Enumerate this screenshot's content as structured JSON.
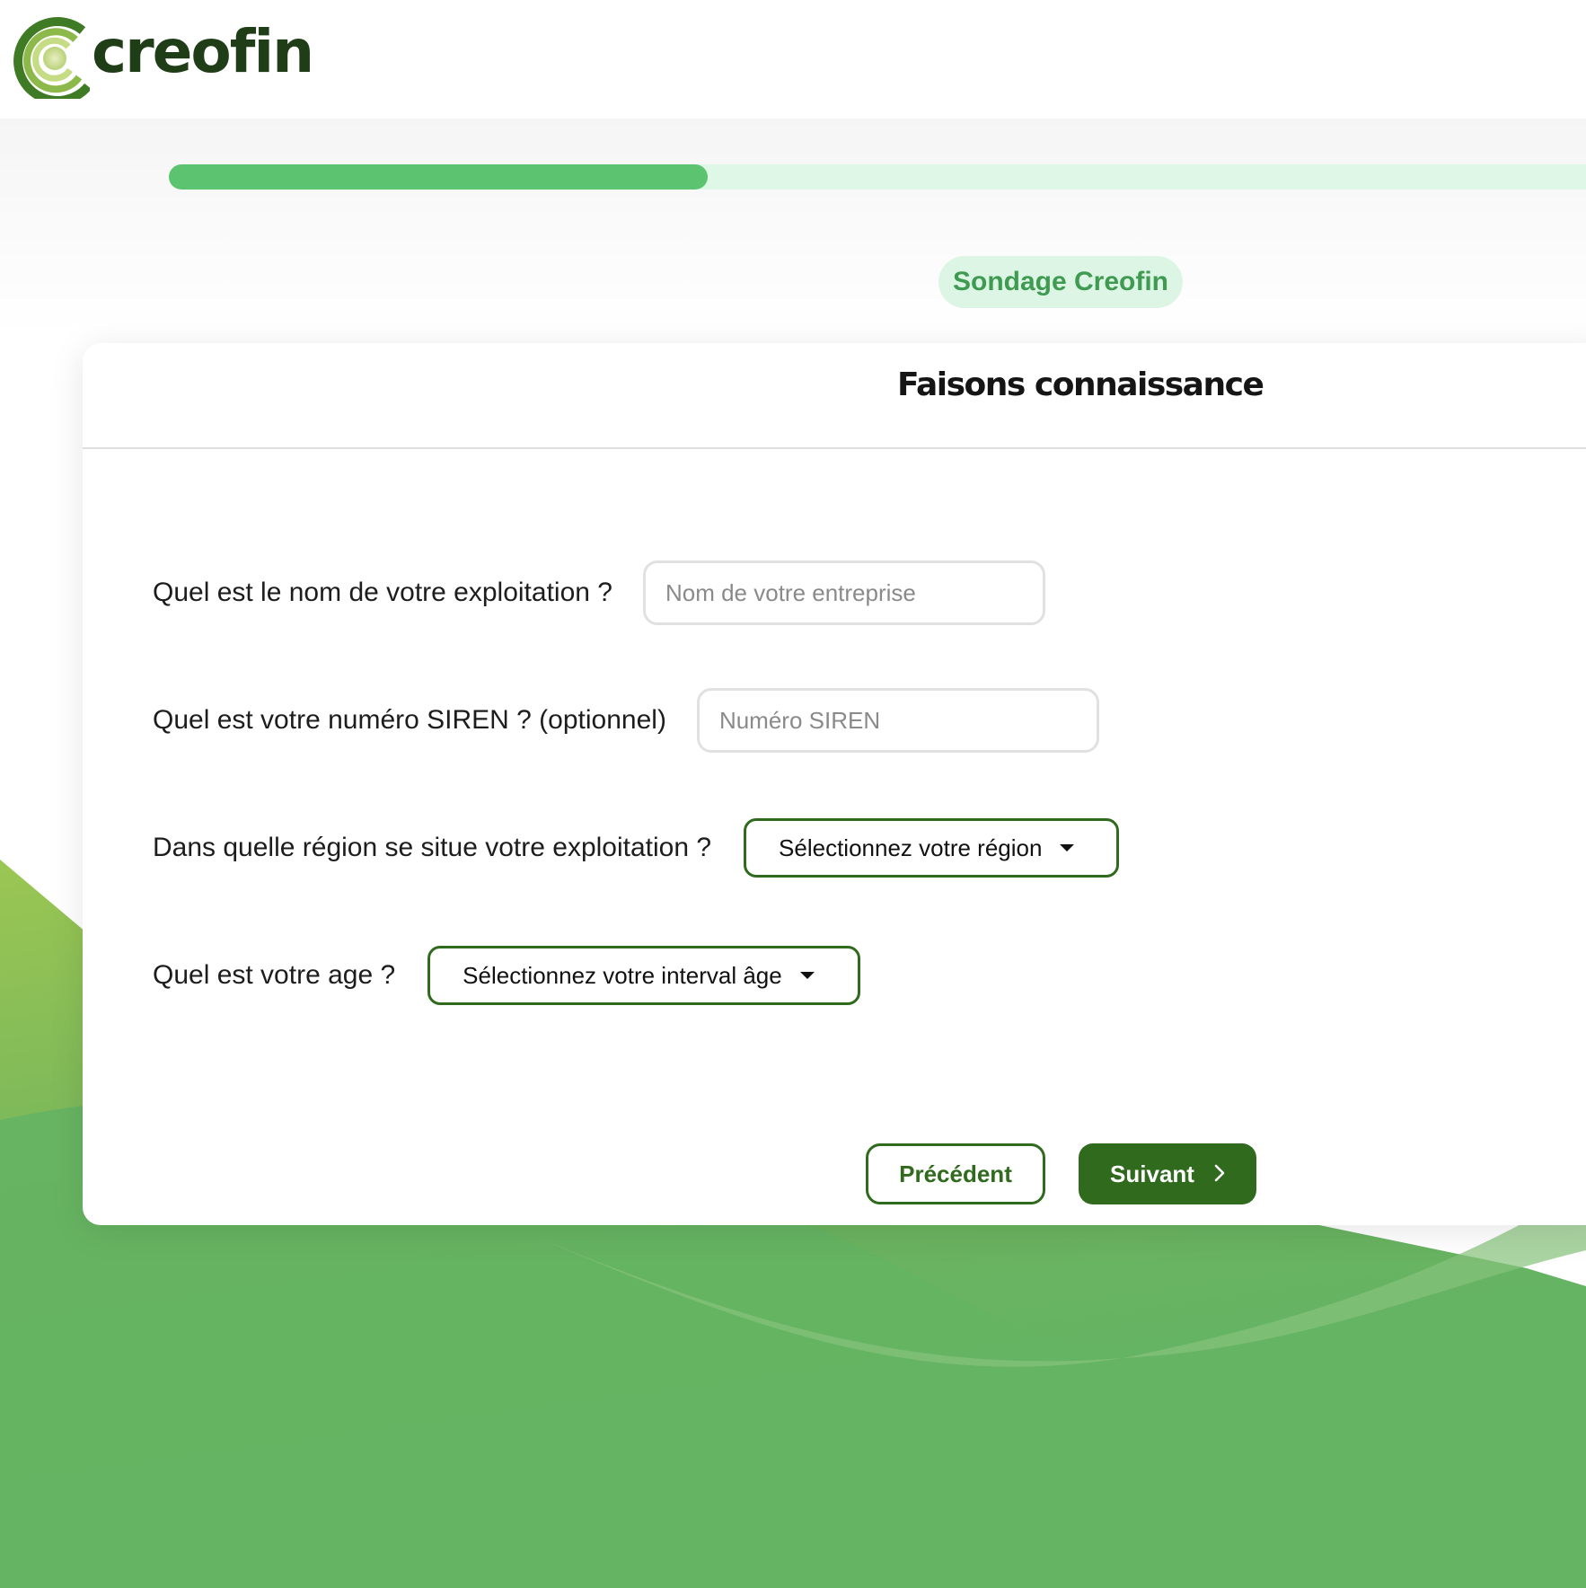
{
  "brand": {
    "name": "creofin"
  },
  "progress": {
    "percent": 38
  },
  "survey": {
    "badge": "Sondage Creofin",
    "title": "Faisons connaissance"
  },
  "questions": {
    "company_name": {
      "label": "Quel est le nom de votre exploitation ?",
      "placeholder": "Nom de votre entreprise",
      "value": ""
    },
    "siren": {
      "label": "Quel est votre numéro SIREN ? (optionnel)",
      "placeholder": "Numéro SIREN",
      "value": ""
    },
    "region": {
      "label": "Dans quelle région se situe votre exploitation ?",
      "selected": "Sélectionnez votre région"
    },
    "age": {
      "label": "Quel est votre age ?",
      "selected": "Sélectionnez votre interval âge"
    }
  },
  "actions": {
    "previous": "Précédent",
    "next": "Suivant"
  },
  "icons": {
    "logo": "creofin-c-logo-icon",
    "dropdown": "caret-down-icon",
    "next": "chevron-right-icon"
  },
  "colors": {
    "brand_dark": "#2f6a1d",
    "progress": "#5cc470",
    "progress_track": "#dff7e6",
    "badge_bg": "#ddf5e4",
    "badge_text": "#3f9a52"
  }
}
